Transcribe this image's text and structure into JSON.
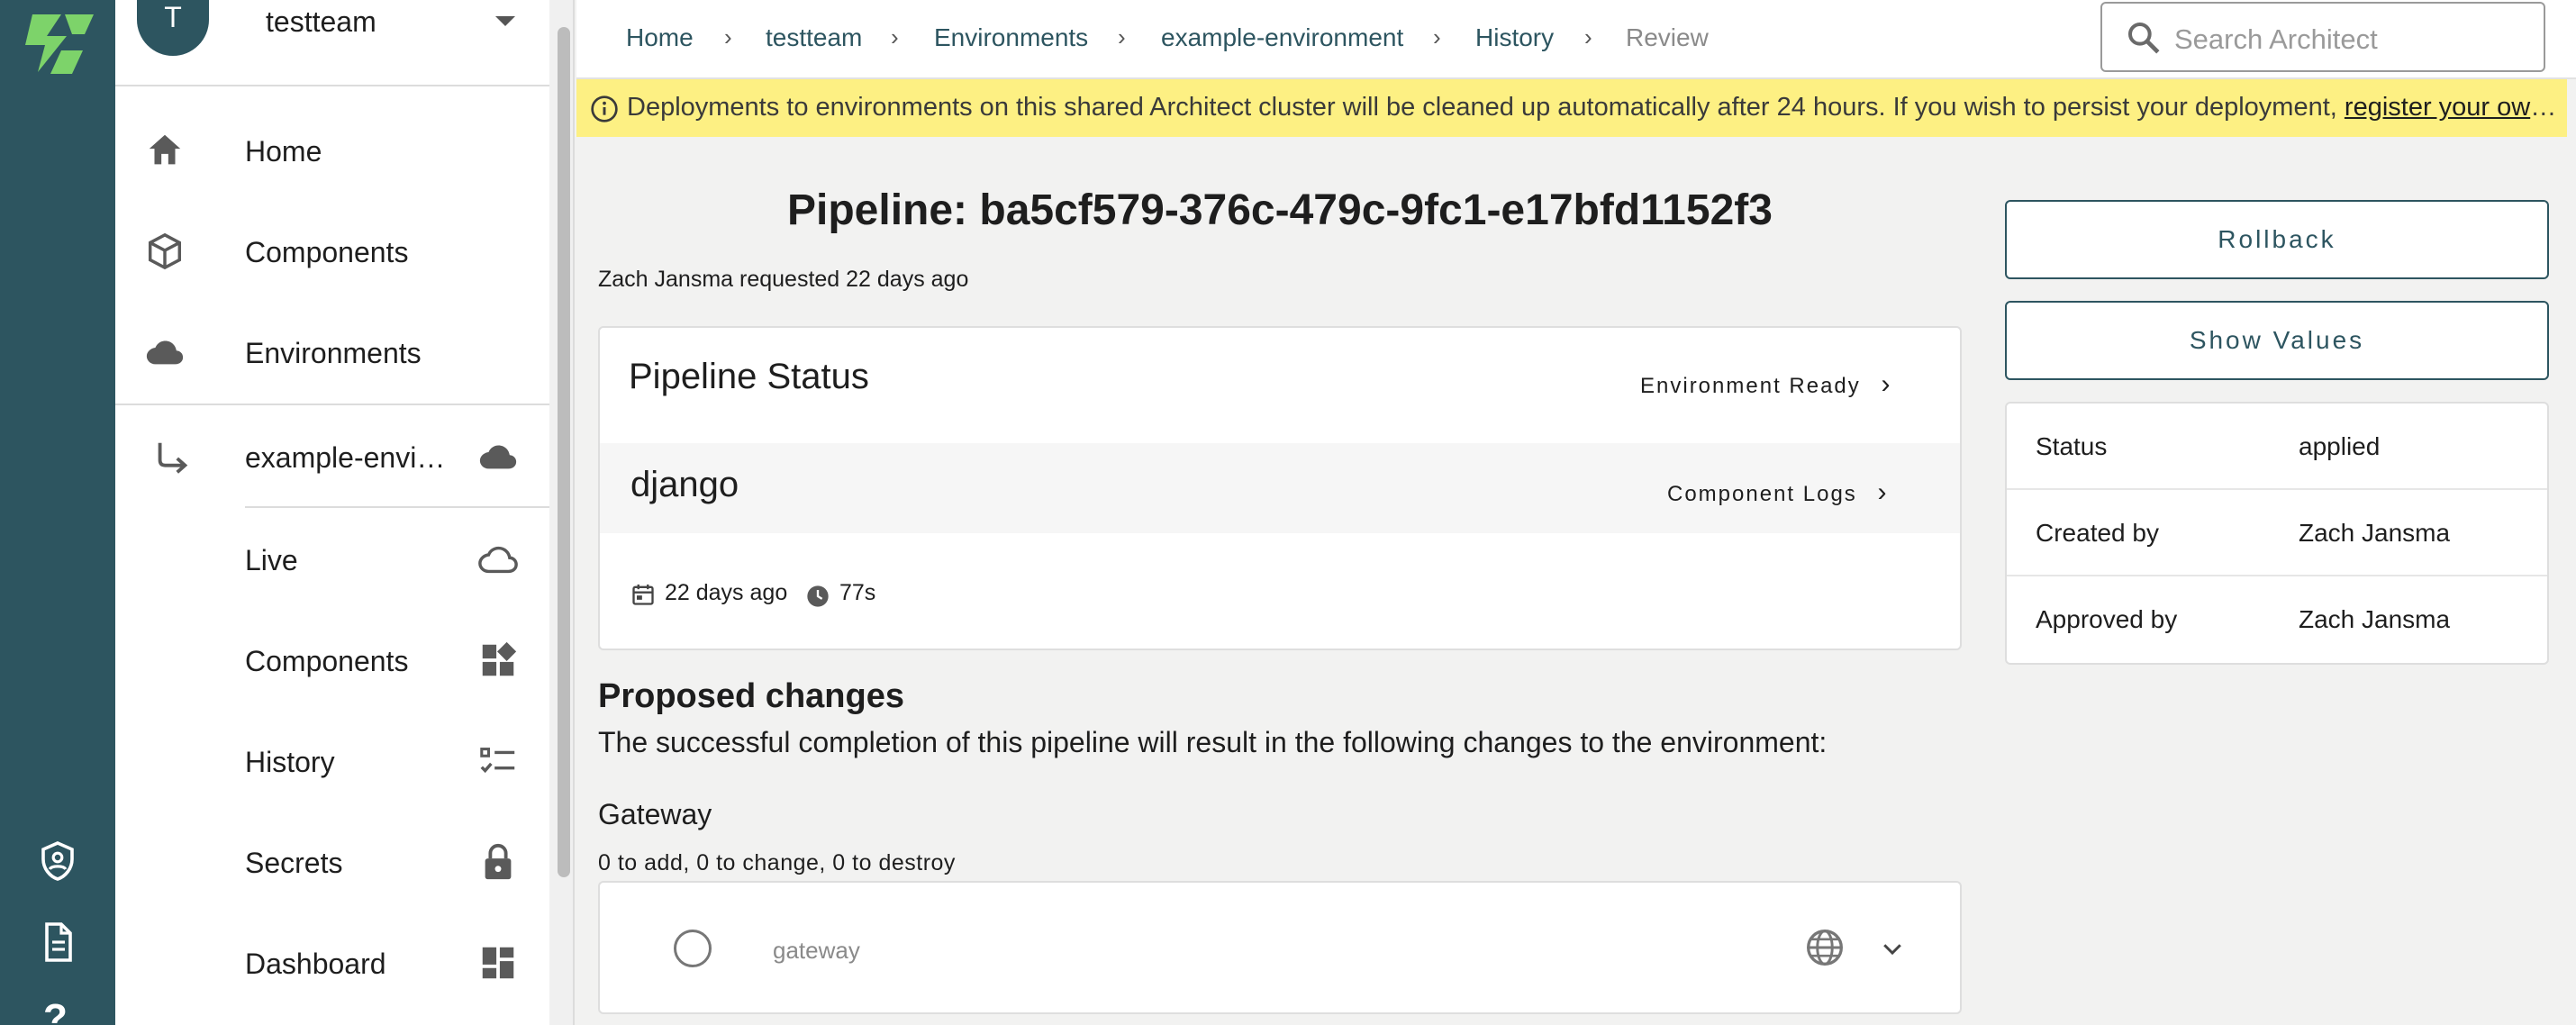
{
  "team": {
    "avatar_letter": "T",
    "name": "testteam"
  },
  "sidebar": {
    "items": [
      {
        "label": "Home",
        "icon": "home-icon"
      },
      {
        "label": "Components",
        "icon": "cube-icon"
      },
      {
        "label": "Environments",
        "icon": "cloud-icon"
      }
    ],
    "environment": {
      "label": "example-envi…",
      "icon": "cloud-icon"
    },
    "sub_items": [
      {
        "label": "Live",
        "icon": "cloud-outline-icon"
      },
      {
        "label": "Components",
        "icon": "widgets-icon"
      },
      {
        "label": "History",
        "icon": "checklist-icon"
      },
      {
        "label": "Secrets",
        "icon": "lock-icon"
      },
      {
        "label": "Dashboard",
        "icon": "dashboard-icon"
      }
    ]
  },
  "rail": {
    "icons": [
      "architect-logo",
      "shield-account-icon",
      "document-icon",
      "help-icon"
    ],
    "help_glyph": "?"
  },
  "breadcrumb": [
    "Home",
    "testteam",
    "Environments",
    "example-environment",
    "History",
    "Review"
  ],
  "search": {
    "placeholder": "Search Architect"
  },
  "banner": {
    "text": "Deployments to environments on this shared Architect cluster will be cleaned up automatically after 24 hours. If you wish to persist your deployment, ",
    "link": "register your own cluster"
  },
  "pipeline": {
    "title": "Pipeline: ba5cf579-376c-479c-9fc1-e17bfd1152f3",
    "requested": "Zach Jansma requested 22 days ago",
    "status_title": "Pipeline Status",
    "env_ready": "Environment Ready",
    "component": "django",
    "component_logs": "Component Logs",
    "age": "22 days ago",
    "duration": "77s"
  },
  "proposed": {
    "heading": "Proposed changes",
    "description": "The successful completion of this pipeline will result in the following changes to the environment:",
    "gateway_title": "Gateway",
    "gateway_summary": "0 to add, 0 to change, 0 to destroy",
    "gateway_item": "gateway"
  },
  "actions": {
    "rollback": "Rollback",
    "show_values": "Show Values"
  },
  "details": [
    {
      "key": "Status",
      "value": "applied"
    },
    {
      "key": "Created by",
      "value": "Zach Jansma"
    },
    {
      "key": "Approved by",
      "value": "Zach Jansma"
    }
  ],
  "colors": {
    "rail": "#2d5560",
    "accent": "#2d5560",
    "banner": "#fdf083",
    "logo": "#7dd36a"
  }
}
